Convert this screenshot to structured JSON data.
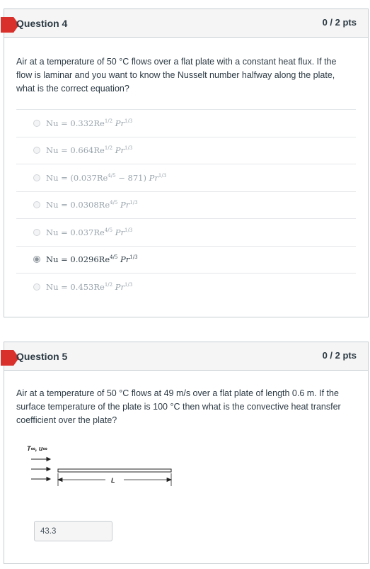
{
  "question4": {
    "title": "Question 4",
    "points": "0 / 2 pts",
    "text": "Air at a temperature of 50 °C flows over a flat plate with a constant heat flux. If the flow is laminar and you want to know the Nusselt number halfway along the plate, what is the correct equation?",
    "selected_index": 5,
    "answers": [
      {
        "coef": "Nu = 0.332Re",
        "re_exp": "1/2",
        "pr_exp": "1/3"
      },
      {
        "coef": "Nu = 0.664Re",
        "re_exp": "1/2",
        "pr_exp": "1/3"
      },
      {
        "coef_pre": "Nu = (0.037Re",
        "re_exp": "4/5",
        "mid": " − 871)",
        "pr_exp": "1/3"
      },
      {
        "coef": "Nu = 0.0308Re",
        "re_exp": "4/5",
        "pr_exp": "1/3"
      },
      {
        "coef": "Nu = 0.037Re",
        "re_exp": "4/5",
        "pr_exp": "1/3"
      },
      {
        "coef": "Nu = 0.0296Re",
        "re_exp": "4/5",
        "pr_exp": "1/3"
      },
      {
        "coef": "Nu = 0.453Re",
        "re_exp": "1/2",
        "pr_exp": "1/3"
      }
    ]
  },
  "question5": {
    "title": "Question 5",
    "points": "0 / 2 pts",
    "text": "Air at a temperature of 50 °C flows at 49 m/s over a flat plate of length 0.6 m. If the surface temperature of the plate is 100 °C then what is the convective heat transfer coefficient over the plate?",
    "diagram": {
      "flow_label": "T∞, u∞",
      "length_label": "L"
    },
    "answer_value": "43.3"
  },
  "colors": {
    "flag": "#d9302b",
    "header_bg": "#f5f5f5",
    "border": "#c7cdd1",
    "text": "#2d3b45",
    "muted_equation": "#9aa5ad"
  },
  "icons": [
    "question-flag-icon",
    "radio-icon",
    "flow-arrow-icon"
  ]
}
